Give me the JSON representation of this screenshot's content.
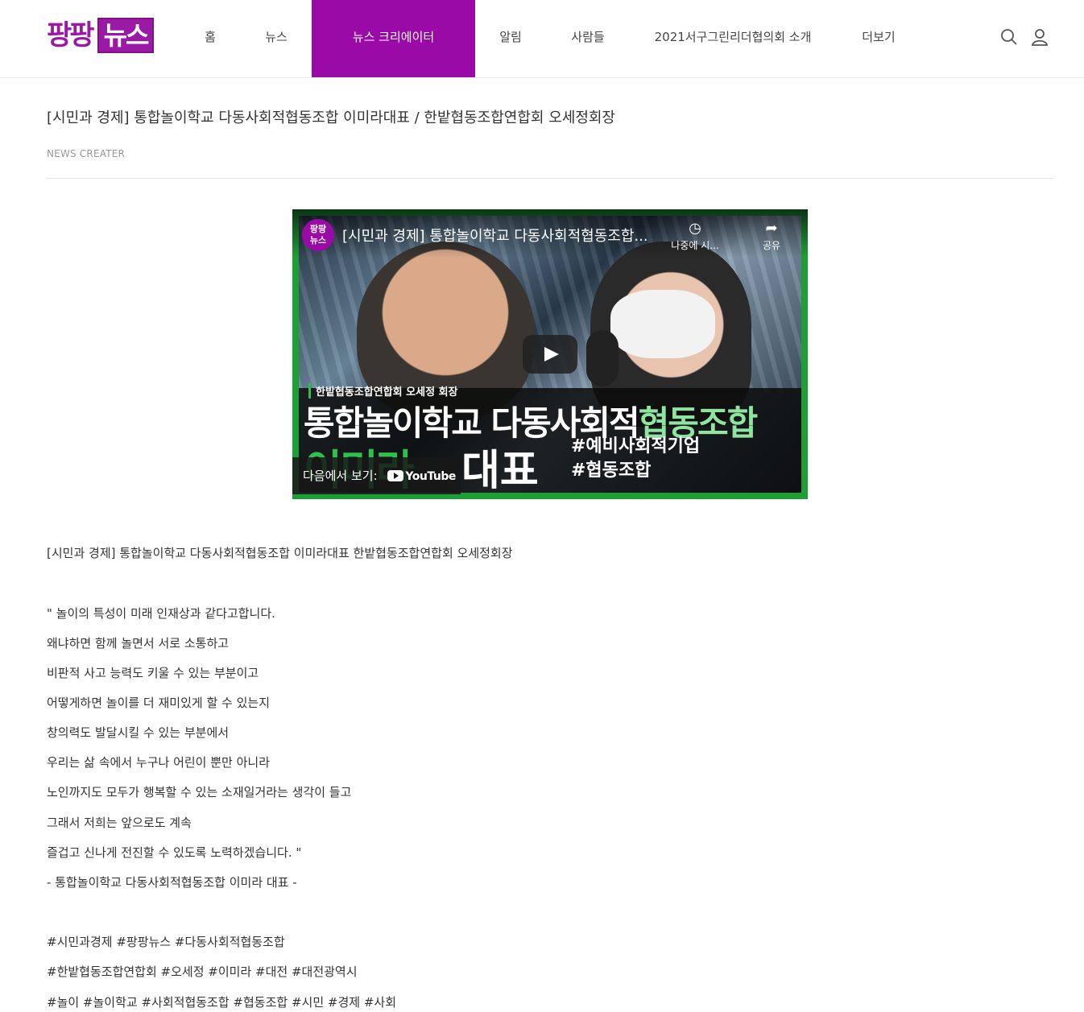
{
  "header": {
    "logo_part1": "팡팡",
    "logo_part2": "뉴스",
    "nav": [
      {
        "label": "홈"
      },
      {
        "label": "뉴스"
      },
      {
        "label": "뉴스 크리에이터"
      },
      {
        "label": "알림"
      },
      {
        "label": "사람들"
      },
      {
        "label": "2021서구그린리더협의회 소개"
      },
      {
        "label": "더보기"
      }
    ],
    "active_nav": "뉴스 크리에이터",
    "accent_color": "#9a0aa6",
    "icons": [
      "search-icon",
      "user-icon"
    ]
  },
  "article": {
    "title": "[시민과 경제] 통합놀이학교 다동사회적협동조합 이미라대표 / 한밭협동조합연합회 오세정회장",
    "category": "NEWS CREATER",
    "video": {
      "channel_badge_1": "팡팡",
      "channel_badge_2": "뉴스",
      "title": "[시민과 경제] 통합놀이학교 다동사회적협동조합...",
      "watch_later": "나중에 시...",
      "share": "공유",
      "overlay_tag": "한밭협동조합연합회 오세정 회장",
      "overlay_main_1": "통합놀이학교 다동사회적",
      "overlay_main_2": "협동조합",
      "overlay_name": "이미라",
      "overlay_role": "대표",
      "overlay_hash_1": "#예비사회적기업",
      "overlay_hash_2": "#협동조합",
      "watch_on": "다음에서 보기:",
      "youtube": "YouTube"
    },
    "paragraphs": [
      "[시민과 경제] 통합놀이학교 다동사회적협동조합 이미라대표 한밭협동조합연합회 오세정회장",
      "\" 놀이의 특성이 미래 인재상과 같다고합니다.",
      "왜냐하면 함께 놀면서 서로 소통하고",
      "비판적 사고 능력도 키울 수 있는 부분이고",
      "어떻게하면 놀이를 더 재미있게 할 수 있는지",
      "창의력도 발달시킬 수 있는 부분에서",
      "우리는 삶 속에서 누구나 어린이 뿐만 아니라",
      "노인까지도 모두가 행복할 수 있는 소재일거라는 생각이 들고",
      "그래서 저희는 앞으로도 계속",
      "즐겁고 신나게 전진할 수 있도록 노력하겠습니다. \"",
      "- 통합놀이학교 다동사회적협동조합 이미라 대표 -",
      "#시민과경제 #팡팡뉴스 #다동사회적협동조합",
      "#한밭협동조합연합회 #오세정 #이미라 #대전 #대전광역시",
      "#놀이 #놀이학교 #사회적협동조합 #협동조합 #시민 #경제 #사회"
    ]
  }
}
